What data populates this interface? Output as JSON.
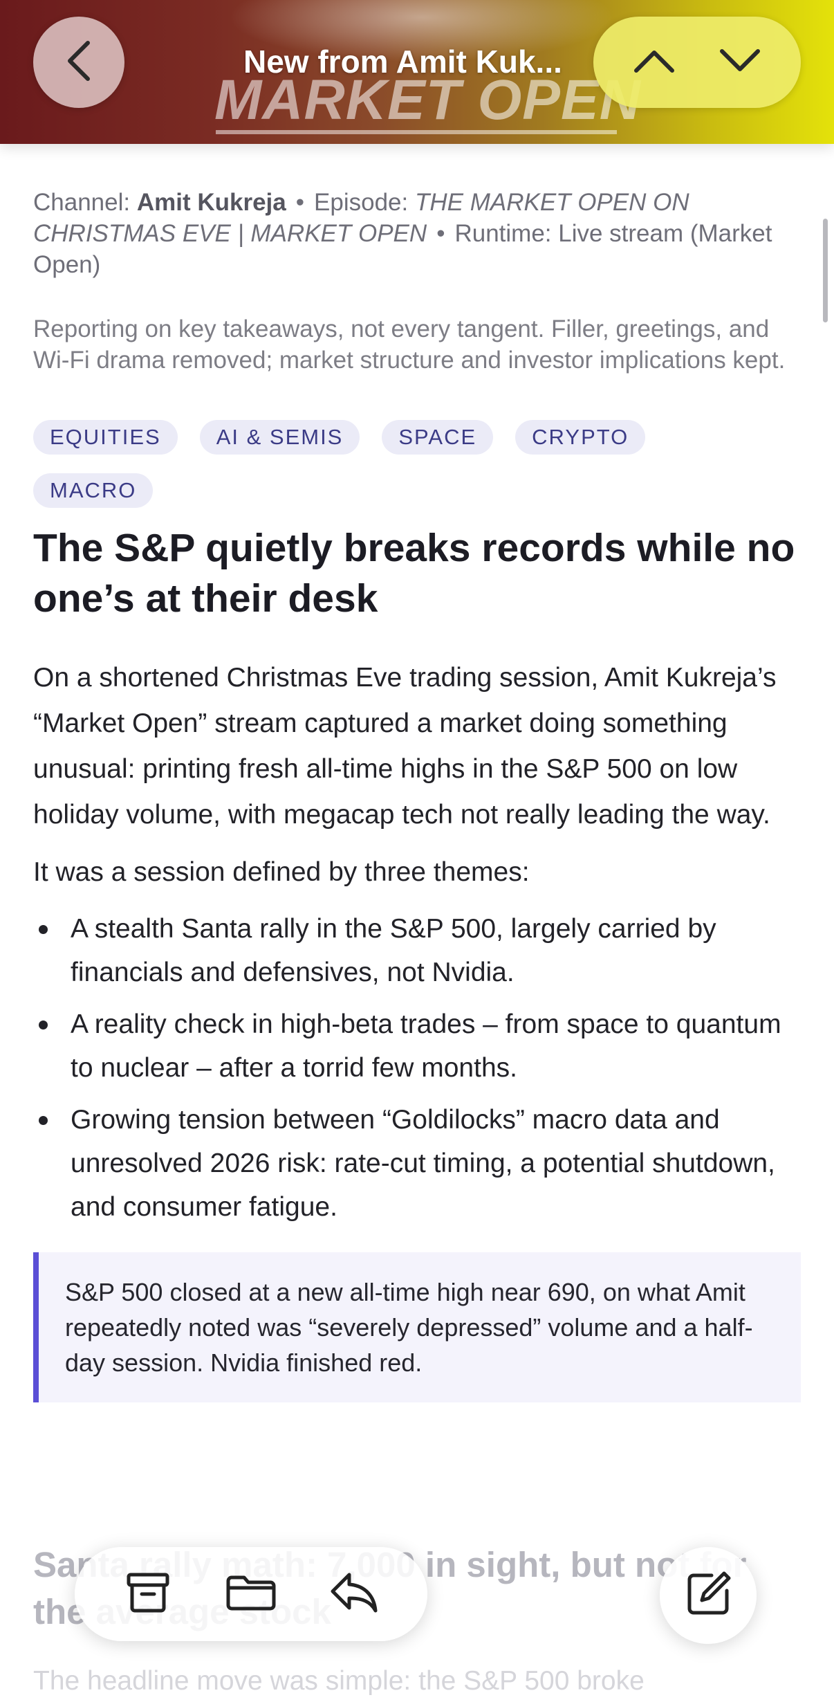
{
  "header": {
    "title": "New from Amit Kuk...",
    "watermark": "MARKET OPEN",
    "hero_colors": [
      "#6a1a1c",
      "#e4e20a"
    ]
  },
  "meta": {
    "channel_label": "Channel:",
    "channel": "Amit Kukreja",
    "separator": "•",
    "episode_label": "Episode:",
    "episode": "THE MARKET OPEN ON CHRISTMAS EVE | MARKET OPEN",
    "runtime_label": "Runtime:",
    "runtime": "Live stream (Market Open)"
  },
  "editor_note": "Reporting on key takeaways, not every tangent. Filler, greetings, and Wi-Fi drama removed; market structure and investor implications kept.",
  "tags": [
    "EQUITIES",
    "AI & SEMIS",
    "SPACE",
    "CRYPTO",
    "MACRO"
  ],
  "article": {
    "headline": "The S&P quietly breaks records while no one’s at their desk",
    "intro": "On a shortened Christmas Eve trading session, Amit Kukreja’s “Market Open” stream captured a market doing something unusual: printing fresh all-time highs in the S&P 500 on low holiday volume, with megacap tech not really leading the way.",
    "themes_intro": "It was a session defined by three themes:",
    "themes": [
      "A stealth Santa rally in the S&P 500, largely carried by financials and defensives, not Nvidia.",
      "A reality check in high-beta trades – from space to quantum to nuclear – after a torrid few months.",
      "Growing tension between “Goldilocks” macro data and unresolved 2026 risk: rate-cut timing, a potential shutdown, and consumer fatigue."
    ],
    "callout": "S&P 500 closed at a new all-time high near 690, on what Amit repeatedly noted was “severely depressed” volume and a half-day session. Nvidia finished red.",
    "section_heading": "Santa rally math: 7,000 in sight, but not for the average stock",
    "section_para": "The headline move was simple: the S&P 500 broke"
  },
  "accent_color": "#5b4fd6",
  "icons": {
    "back": "chevron-left-icon",
    "prev": "chevron-up-icon",
    "next": "chevron-down-icon",
    "archive": "archive-box-icon",
    "folder": "folder-icon",
    "reply": "reply-arrow-icon",
    "compose": "compose-icon"
  }
}
